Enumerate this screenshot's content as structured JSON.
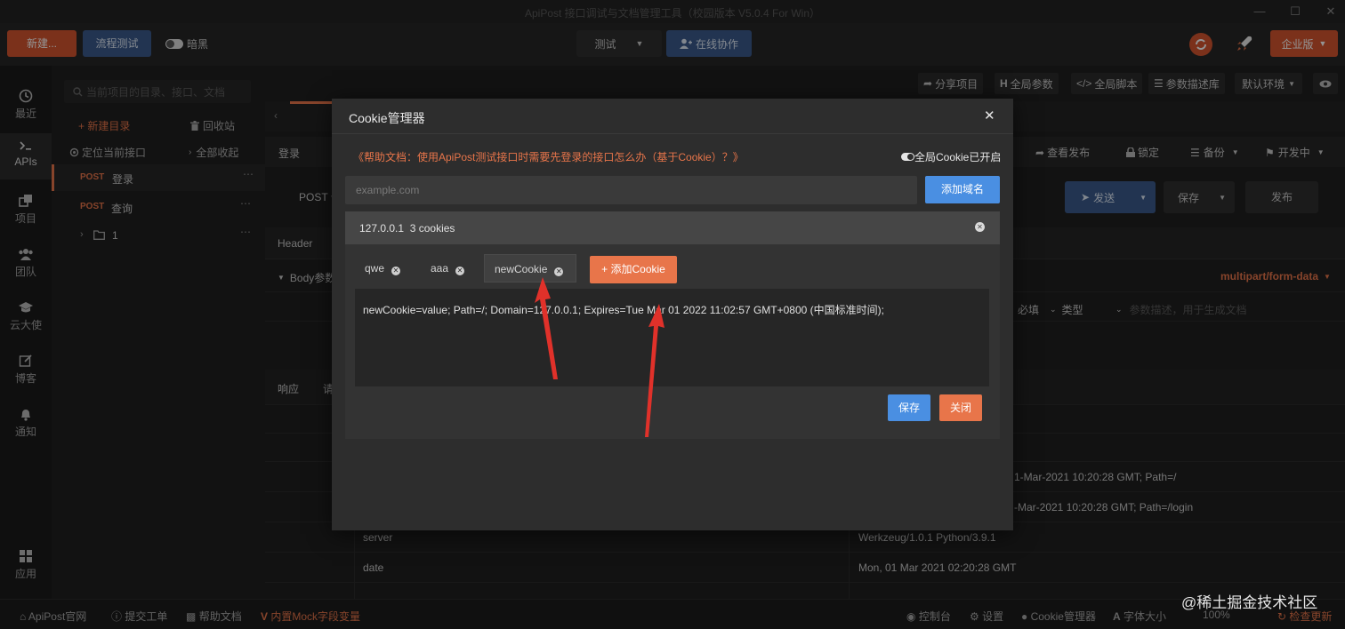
{
  "window": {
    "title": "ApiPost 接口调试与文档管理工具（校园版本 V5.0.4 For Win）"
  },
  "toolbar": {
    "new_label": "新建...",
    "flow_test_label": "流程测试",
    "dark_mode_label": "暗黑",
    "env_label": "测试",
    "collab_label": "在线协作",
    "enterprise_label": "企业版"
  },
  "rail": [
    {
      "label": "最近",
      "icon": "clock-icon"
    },
    {
      "label": "APIs",
      "icon": "terminal-icon"
    },
    {
      "label": "项目",
      "icon": "projects-icon"
    },
    {
      "label": "团队",
      "icon": "team-icon"
    },
    {
      "label": "云大使",
      "icon": "graduation-cap-icon"
    },
    {
      "label": "博客",
      "icon": "edit-icon"
    },
    {
      "label": "通知",
      "icon": "bell-icon"
    },
    {
      "label": "应用",
      "icon": "apps-icon"
    }
  ],
  "tree": {
    "search_placeholder": "当前项目的目录、接口、文档",
    "new_dir_label": "+ 新建目录",
    "recycle_label": "回收站",
    "locate_label": "定位当前接口",
    "collapse_label": "全部收起",
    "items": [
      {
        "method": "POST",
        "name": "登录"
      },
      {
        "method": "POST",
        "name": "查询"
      },
      {
        "method": "",
        "name": "1"
      }
    ]
  },
  "main": {
    "share_label": "分享项目",
    "global_params_label": "全局参数",
    "global_script_label": "全局脚本",
    "param_desc_label": "参数描述库",
    "default_env_label": "默认环境",
    "tab_login": "登录",
    "view_publish_label": "查看发布",
    "lock_label": "锁定",
    "backup_label": "备份",
    "in_dev_label": "开发中",
    "method": "POST",
    "send_label": "发送",
    "save_label": "保存",
    "publish_label": "发布",
    "header_tab": "Header",
    "body_params_label": "Body参数",
    "content_type": "multipart/form-data",
    "required_label": "必填",
    "type_label": "类型",
    "param_desc_placeholder": "参数描述，用于生成文档",
    "response_tab": "响应",
    "request_tab": "请",
    "rows": [
      {
        "key": "",
        "value": "1-Mar-2021 10:20:28 GMT; Path=/"
      },
      {
        "key": "",
        "value": "-Mar-2021 10:20:28 GMT; Path=/login"
      },
      {
        "key": "server",
        "value": "Werkzeug/1.0.1 Python/3.9.1"
      },
      {
        "key": "date",
        "value": "Mon, 01 Mar 2021 02:20:28 GMT"
      }
    ]
  },
  "statusbar": {
    "official_site": "ApiPost官网",
    "submit_ticket": "提交工单",
    "help_docs": "帮助文档",
    "mock_vars": "内置Mock字段变量",
    "console": "控制台",
    "settings": "设置",
    "cookie_manager": "Cookie管理器",
    "font_size": "字体大小",
    "zoom": "100%",
    "check_update": "检查更新"
  },
  "watermark": "@稀土掘金技术社区",
  "modal": {
    "title": "Cookie管理器",
    "help_link": "《帮助文档：使用ApiPost测试接口时需要先登录的接口怎么办（基于Cookie）？》",
    "global_cookie_label": "全局Cookie已开启",
    "domain_placeholder": "example.com",
    "add_domain_label": "添加域名",
    "domain_entry": "127.0.0.1  3 cookies",
    "cookie_tabs": [
      "qwe",
      "aaa",
      "newCookie"
    ],
    "add_cookie_label": "+ 添加Cookie",
    "cookie_value": "newCookie=value; Path=/; Domain=127.0.0.1; Expires=Tue Mar 01 2022 11:02:57 GMT+0800 (中国标准时间);",
    "save_label": "保存",
    "close_label": "关闭"
  },
  "colors": {
    "accent_blue": "#4a8fe2",
    "accent_orange": "#e8754a",
    "post_method": "#e8754a",
    "annotation_red": "#e0312a",
    "help_link": "#e8754a"
  }
}
